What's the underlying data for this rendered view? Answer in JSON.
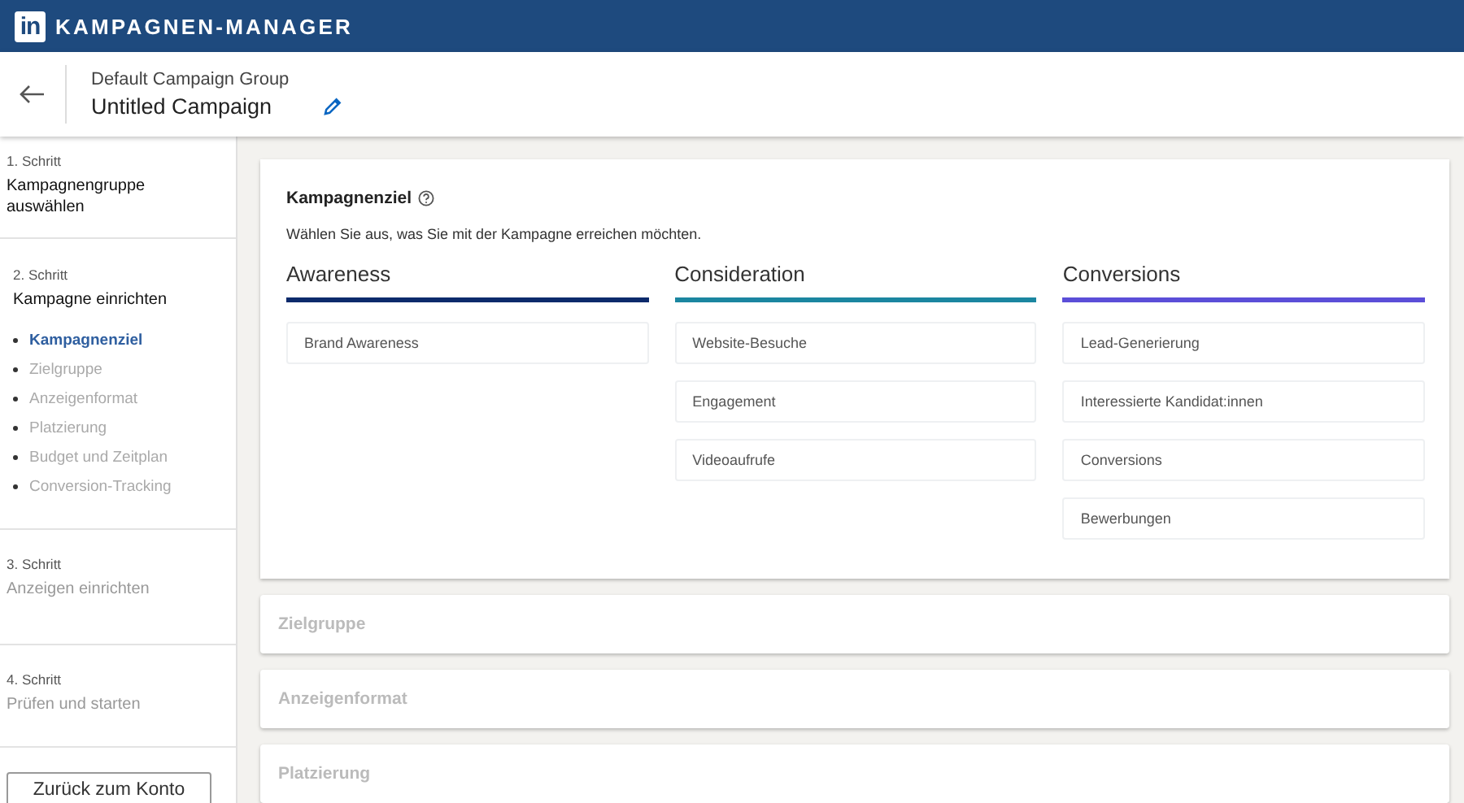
{
  "topbar": {
    "logo": "in",
    "title": "KAMPAGNEN-MANAGER"
  },
  "header": {
    "group": "Default Campaign Group",
    "campaign": "Untitled Campaign"
  },
  "steps": [
    {
      "number": "1. Schritt",
      "title": "Kampagnengruppe auswählen",
      "active": true
    },
    {
      "number": "2. Schritt",
      "title": "Kampagne einrichten",
      "active": true,
      "substeps": [
        {
          "label": "Kampagnenziel",
          "selected": true
        },
        {
          "label": "Zielgruppe",
          "selected": false
        },
        {
          "label": "Anzeigenformat",
          "selected": false
        },
        {
          "label": "Platzierung",
          "selected": false
        },
        {
          "label": "Budget und Zeitplan",
          "selected": false
        },
        {
          "label": "Conversion-Tracking",
          "selected": false
        }
      ]
    },
    {
      "number": "3. Schritt",
      "title": "Anzeigen einrichten",
      "active": false
    },
    {
      "number": "4. Schritt",
      "title": "Prüfen und starten",
      "active": false
    }
  ],
  "back_button": "Zurück zum Konto",
  "objective": {
    "title": "Kampagnenziel",
    "subtitle": "Wählen Sie aus, was Sie mit der Kampagne erreichen möchten.",
    "columns": [
      {
        "name": "Awareness",
        "color": "#0c2a6b",
        "options": [
          "Brand Awareness"
        ]
      },
      {
        "name": "Consideration",
        "color": "#1b86a0",
        "options": [
          "Website-Besuche",
          "Engagement",
          "Videoaufrufe"
        ]
      },
      {
        "name": "Conversions",
        "color": "#5b4ed8",
        "options": [
          "Lead-Generierung",
          "Interessierte Kandidat:innen",
          "Conversions",
          "Bewerbungen"
        ]
      }
    ]
  },
  "sections": [
    "Zielgruppe",
    "Anzeigenformat",
    "Platzierung"
  ]
}
